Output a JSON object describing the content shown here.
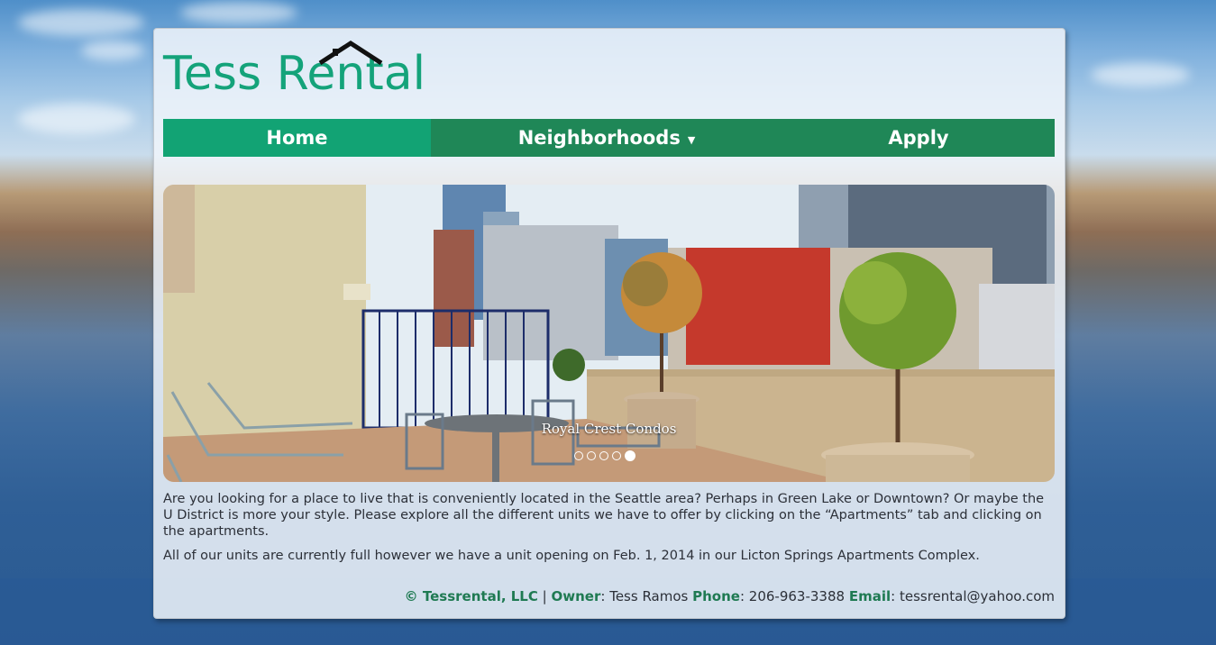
{
  "logo": {
    "text": "Tess Rental"
  },
  "nav": {
    "items": [
      {
        "label": "Home",
        "active": true
      },
      {
        "label": "Neighborhoods"
      },
      {
        "label": "Apply"
      }
    ]
  },
  "slider": {
    "caption": "Royal Crest Condos",
    "dots_total": 5,
    "active_dot": 5
  },
  "content": {
    "paragraph1": "Are you looking for a place to live that is conveniently located in the Seattle area? Perhaps in Green Lake or Downtown? Or maybe the U District is more your style. Please explore all the different units we have to offer by clicking on the “Apartments” tab and clicking on the apartments.",
    "paragraph2": "All of our units are currently full however we have a unit opening on Feb. 1, 2014 in our Licton Springs Apartments Complex."
  },
  "footer": {
    "copyright": "© Tessrental, LLC",
    "separator": "|",
    "owner_label": "Owner",
    "owner_value": "Tess Ramos",
    "phone_label": "Phone",
    "phone_value": "206-963-3388",
    "email_label": "Email",
    "email_value": "tessrental@yahoo.com"
  },
  "colors": {
    "brand": "#14a37a",
    "nav_bg": "#1f8757",
    "nav_active": "#12a374"
  }
}
